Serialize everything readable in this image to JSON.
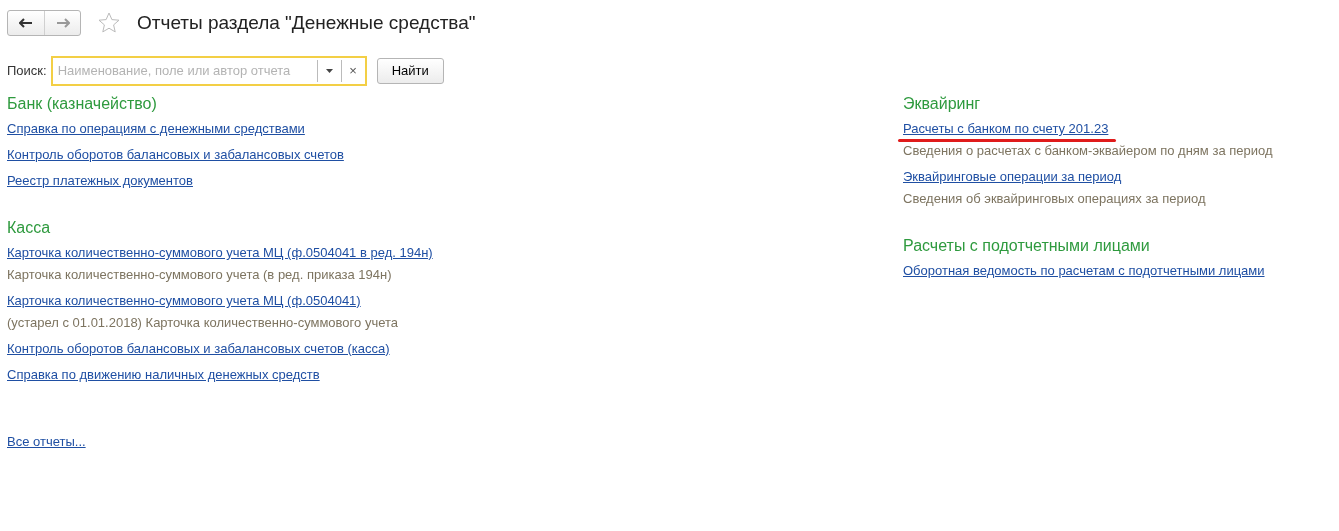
{
  "header": {
    "title": "Отчеты раздела \"Денежные средства\"",
    "favorite": false
  },
  "search": {
    "label": "Поиск:",
    "placeholder": "Наименование, поле или автор отчета",
    "clear": "×",
    "button": "Найти"
  },
  "columns": [
    {
      "sections": [
        {
          "title": "Банк (казначейство)",
          "items": [
            {
              "kind": "link",
              "text": "Справка по операциям с денежными средствами",
              "highlighted": false
            },
            {
              "kind": "link",
              "text": "Контроль оборотов балансовых и забалансовых счетов",
              "highlighted": false
            },
            {
              "kind": "link",
              "text": "Реестр платежных документов",
              "highlighted": false
            }
          ]
        },
        {
          "title": "Касса",
          "items": [
            {
              "kind": "link",
              "text": "Карточка количественно-суммового учета МЦ  (ф.0504041 в ред. 194н)",
              "highlighted": false
            },
            {
              "kind": "note",
              "text": "Карточка количественно-суммового учета (в ред. приказа 194н)"
            },
            {
              "kind": "link",
              "text": "Карточка количественно-суммового учета МЦ  (ф.0504041)",
              "highlighted": false
            },
            {
              "kind": "note",
              "text": "(устарел с 01.01.2018) Карточка количественно-суммового учета"
            },
            {
              "kind": "link",
              "text": "Контроль оборотов балансовых и забалансовых счетов (касса)",
              "highlighted": false
            },
            {
              "kind": "link",
              "text": "Справка по движению наличных денежных средств",
              "highlighted": false
            }
          ]
        }
      ]
    },
    {
      "sections": [
        {
          "title": "Эквайринг",
          "items": [
            {
              "kind": "link",
              "text": "Расчеты с банком по счету 201.23",
              "highlighted": true
            },
            {
              "kind": "note",
              "text": "Сведения о расчетах с банком-эквайером по дням за период"
            },
            {
              "kind": "link",
              "text": "Эквайринговые операции за период",
              "highlighted": false
            },
            {
              "kind": "note",
              "text": "Сведения об эквайринговых операциях за период"
            }
          ]
        },
        {
          "title": "Расчеты с подотчетными лицами",
          "items": [
            {
              "kind": "link",
              "text": "Оборотная ведомость по расчетам с подотчетными лицами",
              "highlighted": false
            }
          ]
        }
      ]
    }
  ],
  "all_reports": "Все отчеты..."
}
